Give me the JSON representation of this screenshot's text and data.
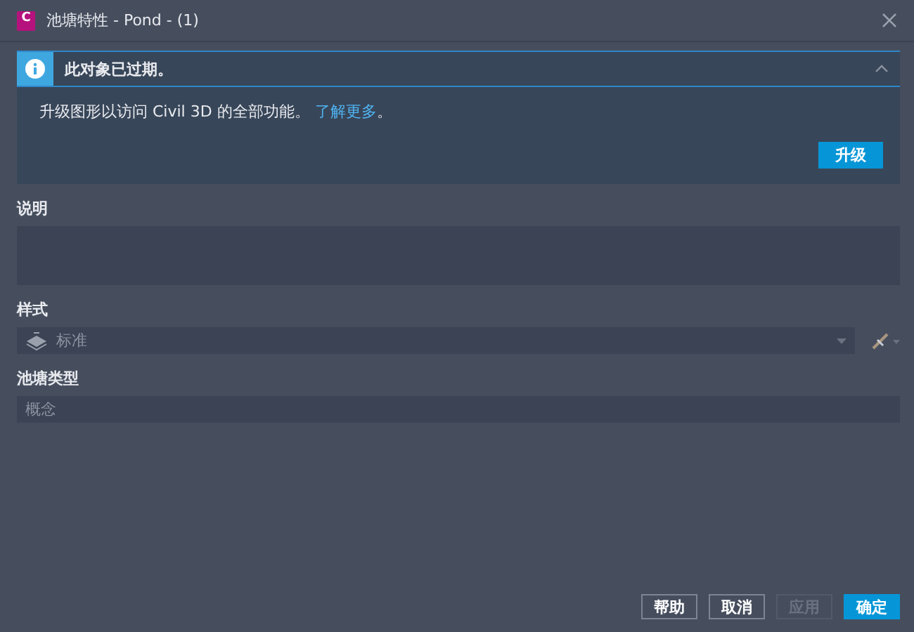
{
  "window": {
    "app_badge": "C",
    "title": "池塘特性 - Pond - (1)"
  },
  "notice": {
    "title": "此对象已过期。",
    "expanded": true,
    "message": "升级图形以访问 Civil 3D 的全部功能。",
    "link": "了解更多",
    "after_link": "。",
    "action": "升级"
  },
  "fields": [
    {
      "kind": "textarea",
      "label": "说明"
    },
    {
      "kind": "select",
      "label": "样式",
      "value": "标准",
      "disabled": true
    },
    {
      "kind": "text",
      "label": "池塘类型",
      "value": "概念",
      "disabled": true
    }
  ],
  "buttons": [
    {
      "label": "帮助",
      "kind": "default",
      "disabled": false
    },
    {
      "label": "取消",
      "kind": "default",
      "disabled": false
    },
    {
      "label": "应用",
      "kind": "default",
      "disabled": true
    },
    {
      "label": "确定",
      "kind": "primary",
      "disabled": false
    }
  ]
}
